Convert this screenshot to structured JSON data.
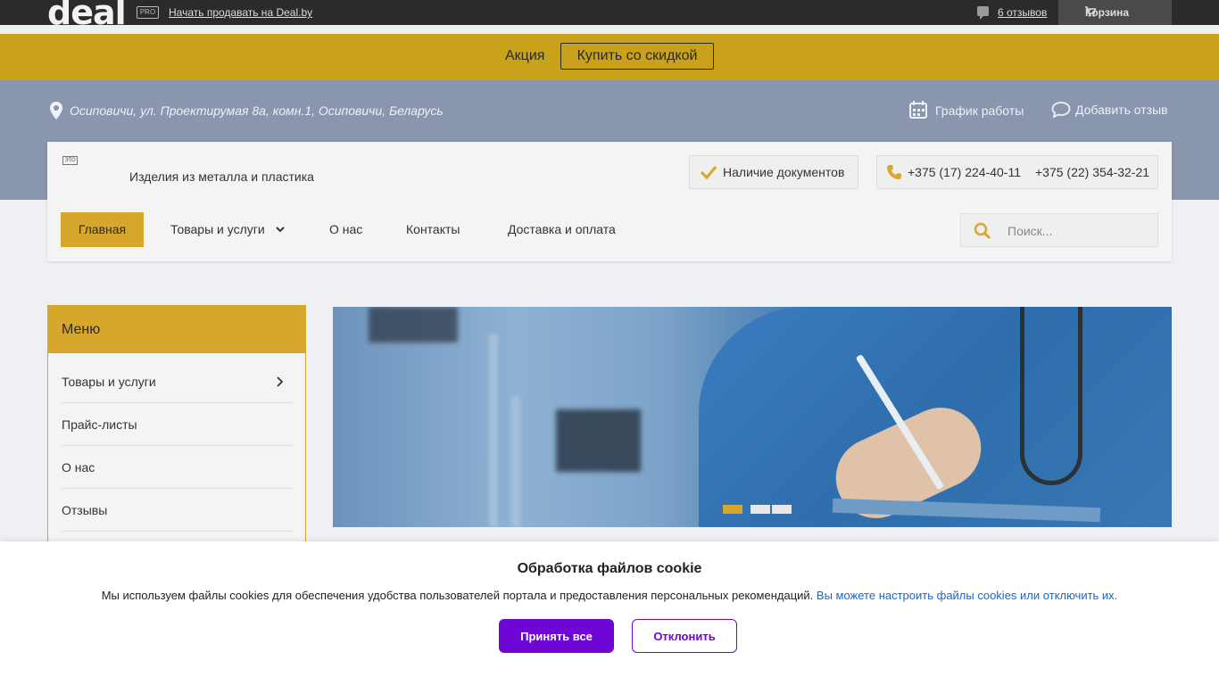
{
  "topbar": {
    "logo": "deal",
    "pro_badge": "PRO",
    "sell_link": "Начать продавать на Deal.by",
    "reviews_link": "6 отзывов",
    "cart_label": "Корзина"
  },
  "promo": {
    "label": "Акция",
    "button": "Купить со скидкой"
  },
  "header": {
    "address": "Осиповичи, ул. Проектирумая 8а, комн.1, Осиповичи, Беларусь",
    "schedule": "График работы",
    "add_review": "Добавить отзыв"
  },
  "company": {
    "logo_text": "ЭТО",
    "name": "Изделия из металла и пластика",
    "documents": "Наличие документов",
    "phones": [
      "+375 (17) 224-40-11",
      "+375 (22) 354-32-21"
    ]
  },
  "nav": {
    "items": [
      "Главная",
      "Товары и услуги",
      "О нас",
      "Контакты",
      "Доставка и оплата"
    ],
    "search_placeholder": "Поиск..."
  },
  "sidebar": {
    "title": "Меню",
    "items": [
      "Товары и услуги",
      "Прайс-листы",
      "О нас",
      "Отзывы"
    ]
  },
  "cookie": {
    "title": "Обработка файлов cookie",
    "text": "Мы используем файлы cookies для обеспечения удобства пользователей портала и предоставления персональных рекомендаций.",
    "link": "Вы можете настроить файлы cookies или отключить их.",
    "accept": "Принять все",
    "decline": "Отклонить"
  },
  "colors": {
    "accent": "#d6a72a",
    "promo": "#c9a11a",
    "band": "#8a96ae",
    "cookie_button": "#6e06d6",
    "link": "#1a66c9"
  }
}
